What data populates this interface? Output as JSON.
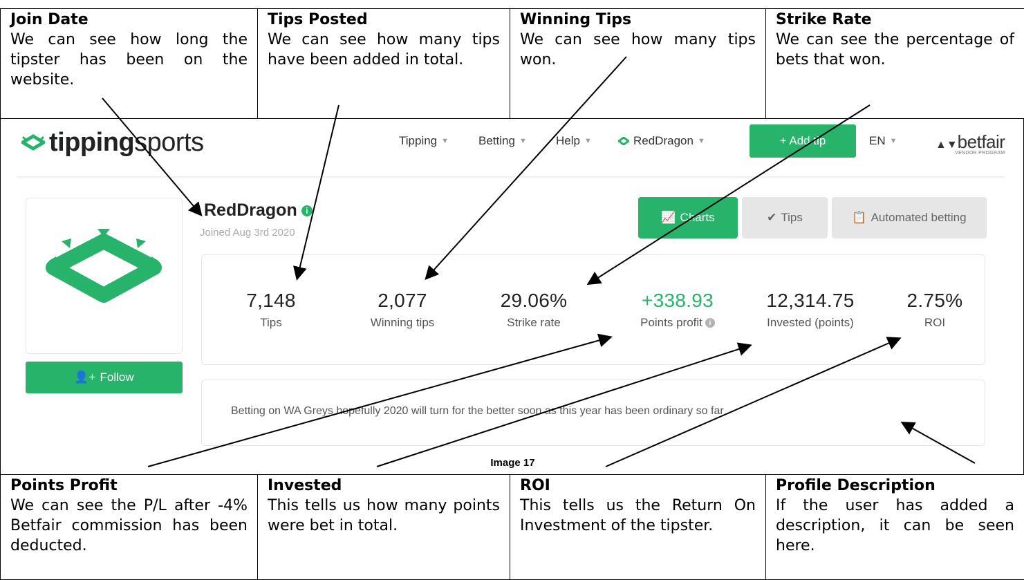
{
  "top_annotations": [
    {
      "title": "Join Date",
      "text": "We can see how long the tipster has been on the website."
    },
    {
      "title": "Tips Posted",
      "text": "We can see how many tips have been added in total."
    },
    {
      "title": "Winning Tips",
      "text": "We can see how many tips won."
    },
    {
      "title": "Strike Rate",
      "text": "We can see the percentage of bets that won."
    }
  ],
  "bottom_annotations": [
    {
      "title": "Points Profit",
      "text": "We can see the P/L after -4% Betfair commission has been deducted."
    },
    {
      "title": "Invested",
      "text": "This tells us how many points were bet in total."
    },
    {
      "title": "ROI",
      "text": "This tells us the Return On Investment of the tipster."
    },
    {
      "title": "Profile Description",
      "text": "If the user has added a description, it can be seen here."
    }
  ],
  "caption": "Image 17",
  "header": {
    "logo_bold": "tipping",
    "logo_light": "sports",
    "nav": [
      "Tipping",
      "Betting",
      "Help"
    ],
    "user": "RedDragon",
    "add_tip": "+ Add tip",
    "language": "EN",
    "betfair": "betfair",
    "betfair_sub": "VENDOR PROGRAM"
  },
  "profile": {
    "username": "RedDragon",
    "joined": "Joined Aug 3rd 2020",
    "follow_label": "Follow",
    "brand_color": "#27b36a"
  },
  "tabs": {
    "charts": "Charts",
    "tips": "Tips",
    "automated": "Automated betting"
  },
  "stats": [
    {
      "value": "7,148",
      "label": "Tips"
    },
    {
      "value": "2,077",
      "label": "Winning tips"
    },
    {
      "value": "29.06%",
      "label": "Strike rate"
    },
    {
      "value": "+338.93",
      "label": "Points profit"
    },
    {
      "value": "12,314.75",
      "label": "Invested (points)"
    },
    {
      "value": "2.75%",
      "label": "ROI"
    }
  ],
  "description": "Betting on WA Greys hopefully 2020 will turn for the better soon as this year has been ordinary so far"
}
